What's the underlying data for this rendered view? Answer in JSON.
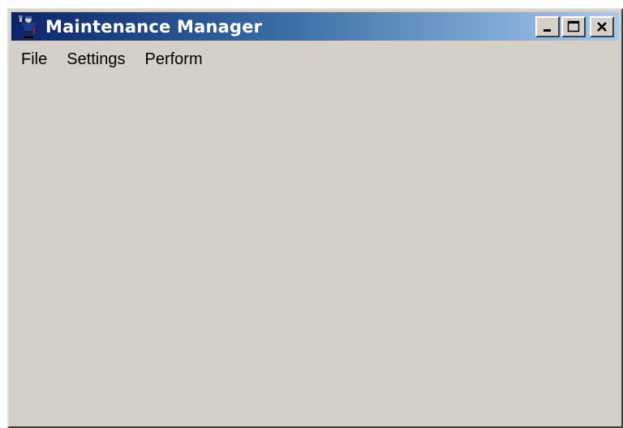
{
  "window": {
    "title": "Maintenance Manager",
    "icon": "maintenance-worker-icon",
    "caption_buttons": [
      "minimize",
      "maximize",
      "close"
    ]
  },
  "menubar": {
    "items": [
      {
        "label": "File"
      },
      {
        "label": "Settings"
      },
      {
        "label": "Perform"
      }
    ]
  },
  "colors": {
    "titlebar_start": "#0a246a",
    "titlebar_end": "#a6caf0",
    "window_face": "#d4d0c8"
  }
}
